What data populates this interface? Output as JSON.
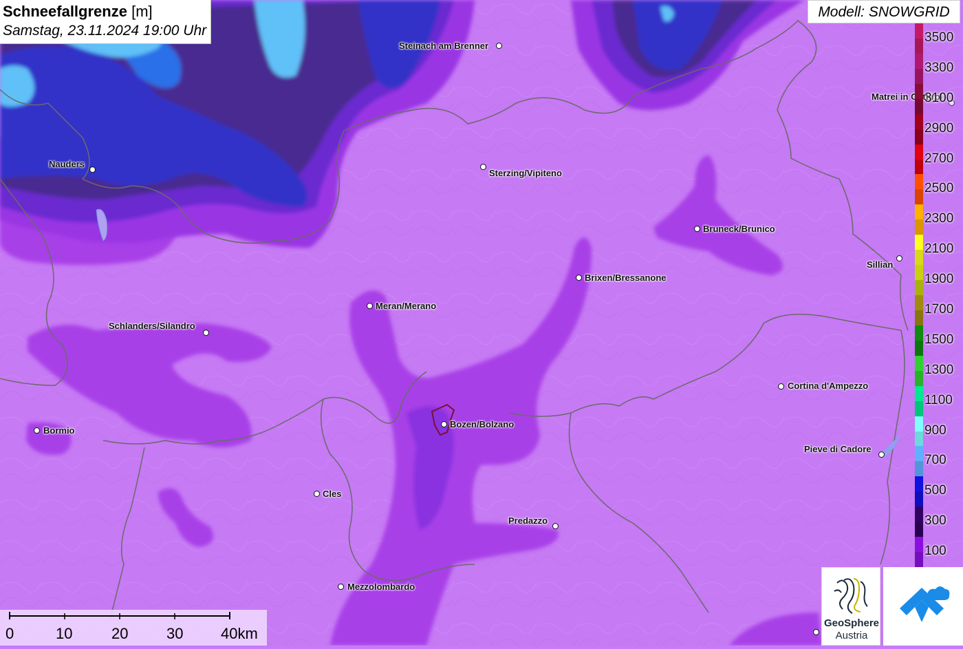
{
  "title": {
    "parameter": "Schneefallgrenze",
    "unit": "[m]",
    "datetime": "Samstag, 23.11.2024 19:00 Uhr"
  },
  "model_label": "Modell: SNOWGRID",
  "legend": {
    "labels": [
      "3500",
      "3300",
      "3100",
      "2900",
      "2700",
      "2500",
      "2300",
      "2100",
      "1900",
      "1700",
      "1500",
      "1300",
      "1100",
      "900",
      "700",
      "500",
      "300",
      "100"
    ],
    "colors": [
      "#c41a66",
      "#b01870",
      "#8a0a3a",
      "#a00020",
      "#e00010",
      "#ff5000",
      "#ffb000",
      "#ffff20",
      "#c8d010",
      "#a08a10",
      "#108a10",
      "#30d030",
      "#00e890",
      "#80ffff",
      "#60b0ff",
      "#1010e0",
      "#300060",
      "#8a10e0"
    ]
  },
  "cities": [
    {
      "name": "Steinach am Brenner"
    },
    {
      "name": "Nauders"
    },
    {
      "name": "Sterzing/Vipiteno"
    },
    {
      "name": "Matrei in Osttirol"
    },
    {
      "name": "Bruneck/Brunico"
    },
    {
      "name": "Sillian"
    },
    {
      "name": "Brixen/Bressanone"
    },
    {
      "name": "Meran/Merano"
    },
    {
      "name": "Schlanders/Silandro"
    },
    {
      "name": "Cortina d'Ampezzo"
    },
    {
      "name": "Bormio"
    },
    {
      "name": "Bozen/Bolzano"
    },
    {
      "name": "Pieve di Cadore"
    },
    {
      "name": "Cles"
    },
    {
      "name": "Predazzo"
    },
    {
      "name": "Mezzolombardo"
    }
  ],
  "scale": {
    "labels": [
      "0",
      "10",
      "20",
      "30",
      "40km"
    ]
  },
  "logo": {
    "line1": "GeoSphere",
    "line2": "Austria"
  }
}
